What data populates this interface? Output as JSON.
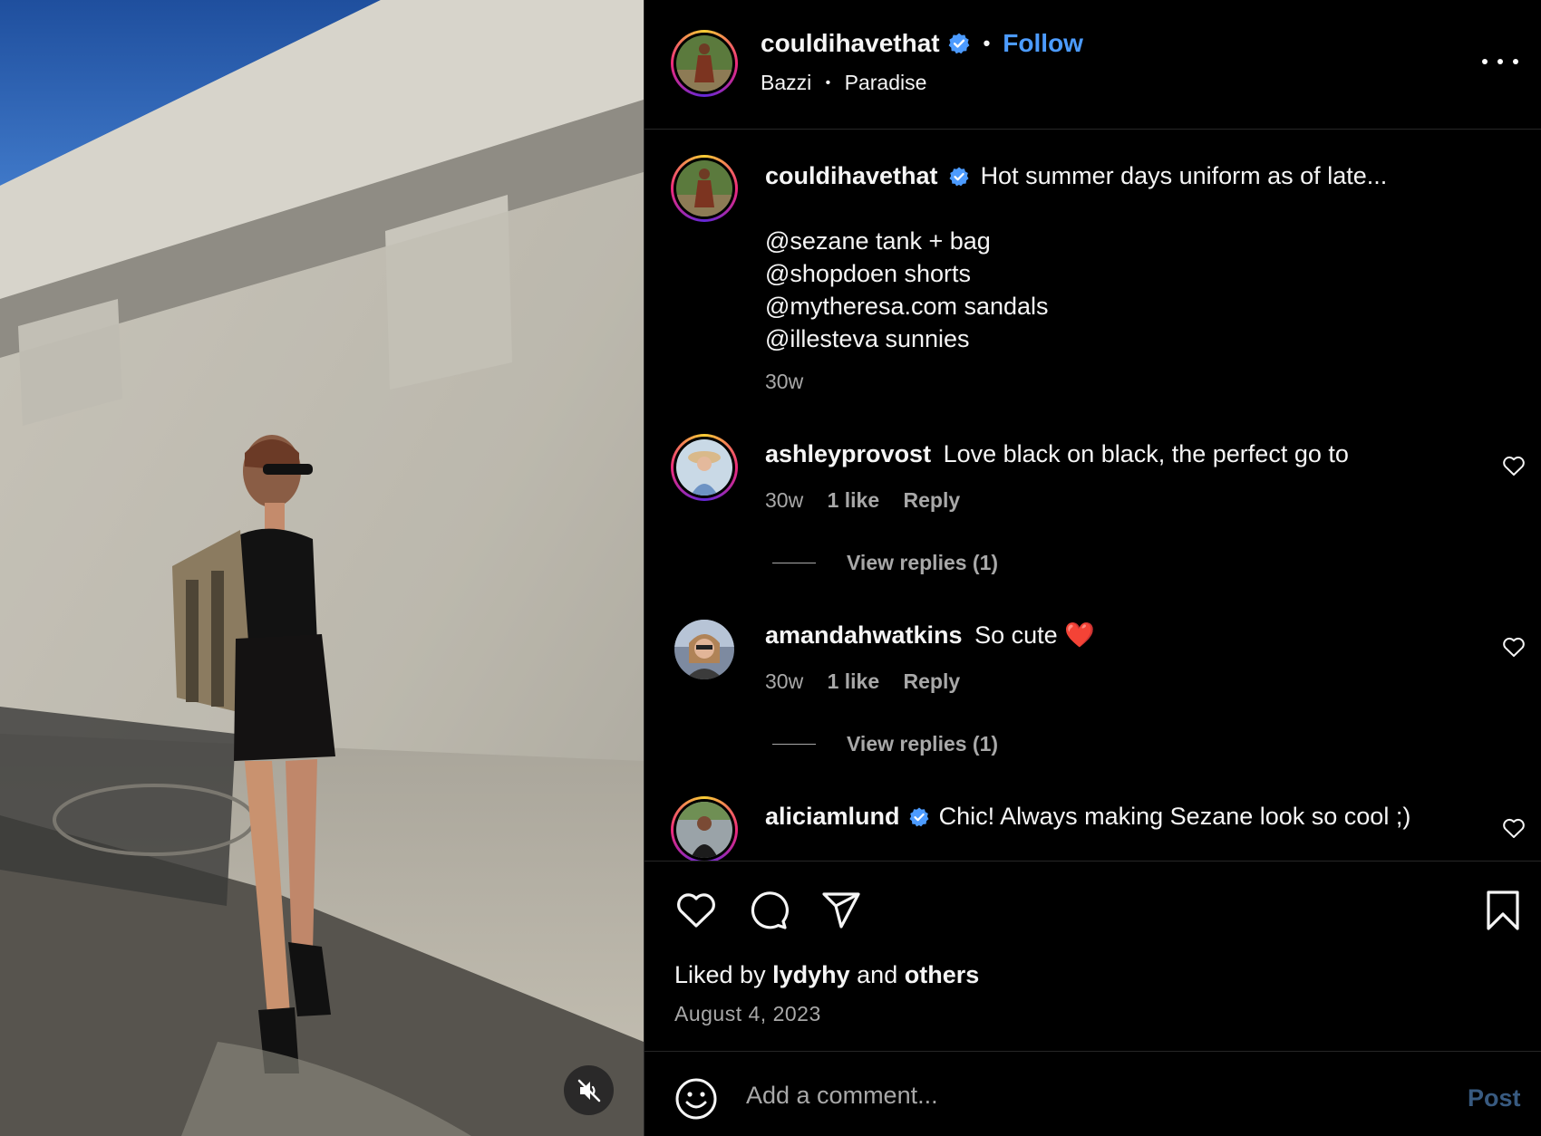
{
  "post": {
    "username": "couldihavethat",
    "follow_label": "Follow",
    "separator": "•",
    "audio_artist": "Bazzi",
    "audio_track": "Paradise"
  },
  "caption": {
    "username": "couldihavethat",
    "text": "Hot summer days uniform as of late...",
    "lines": [
      "@sezane tank + bag",
      "@shopdoen shorts",
      "@mytheresa.com sandals",
      "@illesteva sunnies"
    ],
    "time": "30w"
  },
  "comments": [
    {
      "username": "ashleyprovost",
      "text": "Love black on black, the perfect go to",
      "time": "30w",
      "likes": "1 like",
      "reply_label": "Reply",
      "view_replies": "View replies (1)"
    },
    {
      "username": "amandahwatkins",
      "text": "So cute ❤️",
      "time": "30w",
      "likes": "1 like",
      "reply_label": "Reply",
      "view_replies": "View replies (1)"
    },
    {
      "username": "aliciamlund",
      "text": "Chic! Always making Sezane look so cool ;)"
    }
  ],
  "likes": {
    "prefix": "Liked by",
    "user": "lydyhy",
    "conjunction": "and",
    "others": "others"
  },
  "date": "August 4, 2023",
  "comment_box": {
    "placeholder": "Add a comment...",
    "post_label": "Post"
  },
  "colors": {
    "accent": "#4c9bff",
    "verified": "#4c9bff",
    "muted_text": "#a8a8a8",
    "post_disabled": "#385a80"
  },
  "icons": [
    "verified-badge-icon",
    "more-options-icon",
    "heart-icon",
    "comment-icon",
    "share-icon",
    "bookmark-icon",
    "emoji-icon",
    "mute-icon"
  ]
}
